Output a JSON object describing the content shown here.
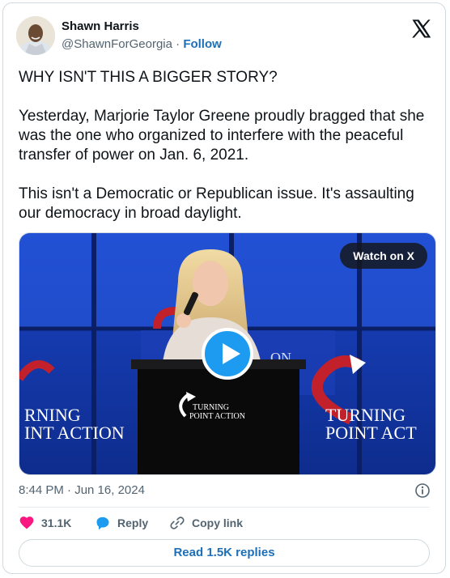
{
  "author": {
    "name": "Shawn Harris",
    "handle": "@ShawnForGeorgia",
    "separator": "·",
    "follow_label": "Follow"
  },
  "tweet": {
    "paragraphs": [
      "WHY ISN'T THIS A BIGGER STORY?",
      "Yesterday, Marjorie Taylor Greene proudly bragged that she was the one who organized to interfere with the peaceful transfer of power on Jan. 6, 2021.",
      "This isn't a Democratic or Republican issue. It's assaulting our democracy in broad daylight."
    ]
  },
  "media": {
    "watch_label": "Watch on X",
    "podium_text_1": "TURNING",
    "podium_text_2": "POINT ACTION",
    "left_sign_1": "RNING",
    "left_sign_2": "INT ACTION",
    "right_sign_1": "TURNING",
    "right_sign_2": "POINT ACT",
    "back_text": "ON"
  },
  "timestamp": "8:44 PM · Jun 16, 2024",
  "actions": {
    "likes": "31.1K",
    "reply": "Reply",
    "copy": "Copy link"
  },
  "read_replies": "Read 1.5K replies",
  "colors": {
    "like": "#f91880",
    "reply": "#1d9bf0",
    "link": "#1d6fb8"
  }
}
